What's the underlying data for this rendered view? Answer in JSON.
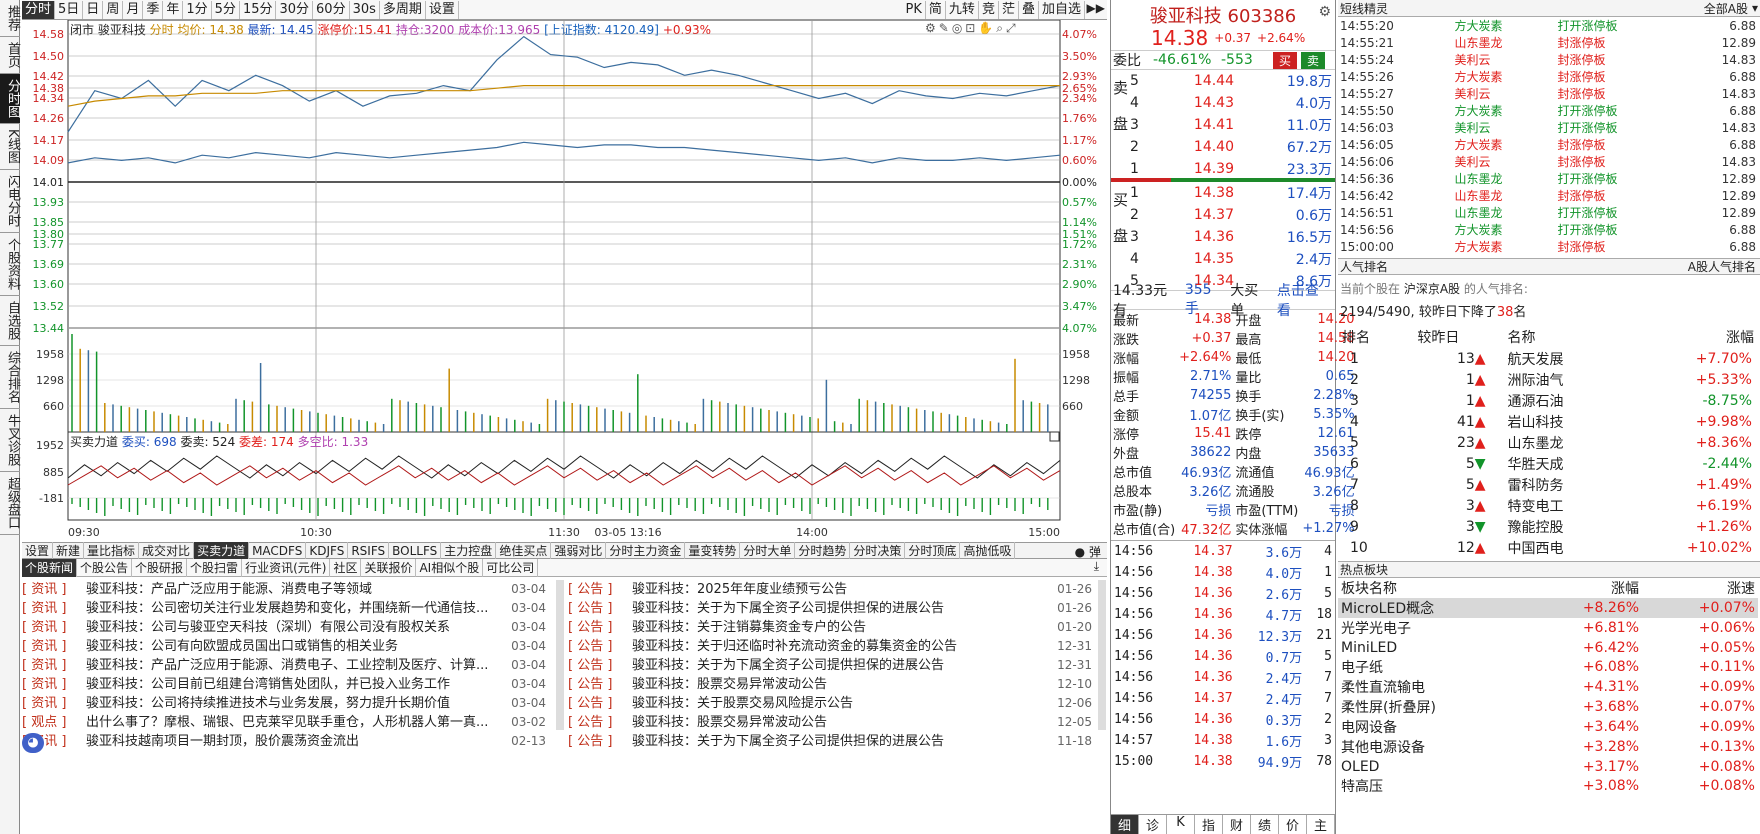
{
  "sidebar": [
    "推荐",
    "首页",
    "分时图",
    "K线图",
    "闪电分时",
    "个股资料",
    "自选股",
    "综合排名",
    "牛叉诊股",
    "超级盘口"
  ],
  "toolbar": {
    "items": [
      "分时",
      "5日",
      "日",
      "周",
      "月",
      "季",
      "年",
      "1分",
      "5分",
      "15分",
      "30分",
      "60分",
      "30s",
      "多周期",
      "设置"
    ],
    "right_items": [
      "PK",
      "简",
      "九转",
      "竞",
      "茫",
      "叠",
      "加自选"
    ]
  },
  "chart_header": {
    "stock": "闭市 骏亚科技",
    "period_label": "分时",
    "avg_label": "均价: 14.38",
    "latest_label": "最新: 14.45",
    "limit_label": "涨停价:15.41",
    "hold_label": "持仓:3200",
    "cost_label": "成本价:13.965",
    "index_label": "[上证指数: 4120.49]",
    "index_change": "+0.93%"
  },
  "price_axis": {
    "left": [
      "14.58",
      "14.50",
      "14.42",
      "14.38",
      "14.34",
      "14.26",
      "14.17",
      "14.09",
      "14.01",
      "13.93",
      "13.85",
      "13.80",
      "13.77",
      "13.69",
      "13.60",
      "13.52",
      "13.44"
    ],
    "right": [
      "4.07%",
      "3.50%",
      "2.93%",
      "2.65%",
      "2.34%",
      "1.76%",
      "1.17%",
      "0.60%",
      "0.00%",
      "0.57%",
      "1.14%",
      "1.51%",
      "1.72%",
      "2.31%",
      "2.90%",
      "3.47%",
      "4.07%"
    ],
    "volume_left": [
      "1958",
      "1298",
      "660"
    ],
    "volume_right": [
      "1958",
      "1298",
      "660"
    ],
    "macd_left": [
      "1952",
      "885",
      "-181"
    ]
  },
  "indicator_header": {
    "name": "买卖力道",
    "buy": "委买: 698",
    "sell": "委卖: 524",
    "diff": "委差: 174",
    "ratio": "多空比: 1.33"
  },
  "time_axis": [
    "09:30",
    "10:30",
    "11:30",
    "03-05 13:16",
    "14:00",
    "15:00"
  ],
  "bottom_tabs": [
    "设置",
    "新建",
    "量比指标",
    "成交对比",
    "买卖力道",
    "MACDFS",
    "KDJFS",
    "RSIFS",
    "BOLLFS",
    "主力控盘",
    "绝佳买点",
    "强弱对比",
    "分时主力资金",
    "量变转势",
    "分时大单",
    "分时趋势",
    "分时决策",
    "分时顶底",
    "高抛低吸"
  ],
  "bottom_toggle": "弹",
  "news_tabs": [
    "个股新闻",
    "个股公告",
    "个股研报",
    "个股扫雷",
    "行业资讯(元件)",
    "社区",
    "关联报价",
    "AI相似个股",
    "可比公司"
  ],
  "news_left": [
    {
      "tag": "[ 资讯 ]",
      "text": "骏亚科技：产品广泛应用于能源、消费电子等领域",
      "date": "03-04"
    },
    {
      "tag": "[ 资讯 ]",
      "text": "骏亚科技：公司密切关注行业发展趋势和变化，并围绕新一代通信技...",
      "date": "03-04"
    },
    {
      "tag": "[ 资讯 ]",
      "text": "骏亚科技：公司与骏亚空天科技（深圳）有限公司没有股权关系",
      "date": "03-04"
    },
    {
      "tag": "[ 资讯 ]",
      "text": "骏亚科技：公司有向欧盟成员国出口或销售的相关业务",
      "date": "03-04"
    },
    {
      "tag": "[ 资讯 ]",
      "text": "骏亚科技：产品广泛应用于能源、消费电子、工业控制及医疗、计算...",
      "date": "03-04"
    },
    {
      "tag": "[ 资讯 ]",
      "text": "骏亚科技：公司目前已组建台湾销售处团队，并已投入业务工作",
      "date": "03-04"
    },
    {
      "tag": "[ 资讯 ]",
      "text": "骏亚科技：公司将持续推进技术与业务发展，努力提升长期价值",
      "date": "03-04"
    },
    {
      "tag": "[ 观点 ]",
      "text": "出什么事了？摩根、瑞银、巴克莱罕见联手重仓，人形机器人第一真...",
      "date": "03-02"
    },
    {
      "tag": "[ 资讯 ]",
      "text": "骏亚科技越南项目一期封顶，股价震荡资金流出",
      "date": "02-13"
    }
  ],
  "news_right": [
    {
      "tag": "[ 公告 ]",
      "text": "骏亚科技：2025年年度业绩预亏公告",
      "date": "01-26"
    },
    {
      "tag": "[ 公告 ]",
      "text": "骏亚科技：关于为下属全资子公司提供担保的进展公告",
      "date": "01-26"
    },
    {
      "tag": "[ 公告 ]",
      "text": "骏亚科技：关于注销募集资金专户的公告",
      "date": "01-20"
    },
    {
      "tag": "[ 公告 ]",
      "text": "骏亚科技：关于归还临时补充流动资金的募集资金的公告",
      "date": "12-31"
    },
    {
      "tag": "[ 公告 ]",
      "text": "骏亚科技：关于为下属全资子公司提供担保的进展公告",
      "date": "12-31"
    },
    {
      "tag": "[ 公告 ]",
      "text": "骏亚科技：股票交易异常波动公告",
      "date": "12-10"
    },
    {
      "tag": "[ 公告 ]",
      "text": "骏亚科技：关于股票交易风险提示公告",
      "date": "12-06"
    },
    {
      "tag": "[ 公告 ]",
      "text": "骏亚科技：股票交易异常波动公告",
      "date": "12-05"
    },
    {
      "tag": "[ 公告 ]",
      "text": "骏亚科技：关于为下属全资子公司提供担保的进展公告",
      "date": "11-18"
    }
  ],
  "quote": {
    "name": "骏亚科技",
    "code": "603386",
    "price": "14.38",
    "change": "+0.37",
    "pct": "+2.64%",
    "buy_btn": "买",
    "sell_btn": "卖",
    "wei_label": "委比",
    "wei_ratio": "-46.61%",
    "wei_diff": "-553",
    "sell_label": "卖盘",
    "buy_label": "买盘",
    "sells": [
      {
        "n": "5",
        "p": "14.44",
        "v": "19.8万"
      },
      {
        "n": "4",
        "p": "14.43",
        "v": "4.0万"
      },
      {
        "n": "3",
        "p": "14.41",
        "v": "11.0万"
      },
      {
        "n": "2",
        "p": "14.40",
        "v": "67.2万"
      },
      {
        "n": "1",
        "p": "14.39",
        "v": "23.3万"
      }
    ],
    "buys": [
      {
        "n": "1",
        "p": "14.38",
        "v": "17.4万"
      },
      {
        "n": "2",
        "p": "14.37",
        "v": "0.6万"
      },
      {
        "n": "3",
        "p": "14.36",
        "v": "16.5万"
      },
      {
        "n": "4",
        "p": "14.35",
        "v": "2.4万"
      },
      {
        "n": "5",
        "p": "14.34",
        "v": "8.6万"
      }
    ],
    "bigorder": {
      "price": "14.33元有",
      "vol": "355手",
      "label": "大买单",
      "link": "点击查看"
    },
    "stats": [
      [
        "最新",
        "14.38",
        "开盘",
        "14.20"
      ],
      [
        "涨跌",
        "+0.37",
        "最高",
        "14.58"
      ],
      [
        "涨幅",
        "+2.64%",
        "最低",
        "14.20"
      ],
      [
        "振幅",
        "2.71%",
        "量比",
        "0.65"
      ],
      [
        "总手",
        "74255",
        "换手",
        "2.28%"
      ],
      [
        "金额",
        "1.07亿",
        "换手(实)",
        "5.35%"
      ],
      [
        "涨停",
        "15.41",
        "跌停",
        "12.61"
      ],
      [
        "外盘",
        "38622",
        "内盘",
        "35633"
      ],
      [
        "总市值",
        "46.93亿",
        "流通值",
        "46.93亿"
      ],
      [
        "总股本",
        "3.26亿",
        "流通股",
        "3.26亿"
      ],
      [
        "市盈(静)",
        "亏损",
        "市盈(TTM)",
        "亏损"
      ],
      [
        "总市值(合)",
        "47.32亿",
        "实体涨幅",
        "+1.27%"
      ]
    ],
    "ticks": [
      [
        "14:56",
        "14.37",
        "3.6万",
        "4"
      ],
      [
        "14:56",
        "14.38",
        "4.0万",
        "1"
      ],
      [
        "14:56",
        "14.36",
        "2.6万",
        "5"
      ],
      [
        "14:56",
        "14.36",
        "4.7万",
        "18"
      ],
      [
        "14:56",
        "14.36",
        "12.3万",
        "21"
      ],
      [
        "14:56",
        "14.36",
        "0.7万",
        "5"
      ],
      [
        "14:56",
        "14.36",
        "2.4万",
        "7"
      ],
      [
        "14:56",
        "14.37",
        "2.4万",
        "7"
      ],
      [
        "14:56",
        "14.36",
        "0.3万",
        "2"
      ],
      [
        "14:57",
        "14.38",
        "1.6万",
        "3"
      ],
      [
        "15:00",
        "14.38",
        "94.9万",
        "78"
      ]
    ],
    "bottom_tabs": [
      "细",
      "诊",
      "K",
      "指",
      "财",
      "绩",
      "价",
      "主"
    ]
  },
  "short_elves": {
    "title": "短线精灵",
    "filter": "全部A股",
    "rows": [
      [
        "14:55:20",
        "方大炭素",
        "打开涨停板",
        "6.88"
      ],
      [
        "14:55:21",
        "山东墨龙",
        "封涨停板",
        "12.89"
      ],
      [
        "14:55:24",
        "美利云",
        "封涨停板",
        "14.83"
      ],
      [
        "14:55:26",
        "方大炭素",
        "封涨停板",
        "6.88"
      ],
      [
        "14:55:27",
        "美利云",
        "封涨停板",
        "14.83"
      ],
      [
        "14:55:50",
        "方大炭素",
        "打开涨停板",
        "6.88"
      ],
      [
        "14:56:03",
        "美利云",
        "打开涨停板",
        "14.83"
      ],
      [
        "14:56:05",
        "方大炭素",
        "封涨停板",
        "6.88"
      ],
      [
        "14:56:06",
        "美利云",
        "封涨停板",
        "14.83"
      ],
      [
        "14:56:36",
        "山东墨龙",
        "打开涨停板",
        "12.89"
      ],
      [
        "14:56:42",
        "山东墨龙",
        "封涨停板",
        "12.89"
      ],
      [
        "14:56:51",
        "山东墨龙",
        "打开涨停板",
        "12.89"
      ],
      [
        "14:56:56",
        "方大炭素",
        "打开涨停板",
        "6.88"
      ],
      [
        "15:00:00",
        "方大炭素",
        "封涨停板",
        "6.88"
      ]
    ]
  },
  "popularity": {
    "title": "人气排名",
    "tab": "A股人气排名",
    "line1_pre": "当前个股在",
    "line1_market": "沪深京A股",
    "line1_post": "的人气排名:",
    "rank_text": "2194/5490, 较昨日下降了",
    "rank_drop": "38",
    "rank_unit": "名",
    "headers": [
      "排名",
      "较昨日",
      "名称",
      "涨幅"
    ],
    "rows": [
      {
        "r": "1",
        "d": "13",
        "up": true,
        "n": "航天发展",
        "p": "+7.70%"
      },
      {
        "r": "2",
        "d": "1",
        "up": true,
        "n": "洲际油气",
        "p": "+5.33%"
      },
      {
        "r": "3",
        "d": "1",
        "up": true,
        "n": "通源石油",
        "p": "-8.75%"
      },
      {
        "r": "4",
        "d": "41",
        "up": true,
        "n": "岩山科技",
        "p": "+9.98%"
      },
      {
        "r": "5",
        "d": "23",
        "up": true,
        "n": "山东墨龙",
        "p": "+8.36%"
      },
      {
        "r": "6",
        "d": "5",
        "up": false,
        "n": "华胜天成",
        "p": "-2.44%"
      },
      {
        "r": "7",
        "d": "5",
        "up": true,
        "n": "雷科防务",
        "p": "+1.49%"
      },
      {
        "r": "8",
        "d": "3",
        "up": true,
        "n": "特变电工",
        "p": "+6.19%"
      },
      {
        "r": "9",
        "d": "3",
        "up": false,
        "n": "豫能控股",
        "p": "+1.26%"
      },
      {
        "r": "10",
        "d": "12",
        "up": true,
        "n": "中国西电",
        "p": "+10.02%"
      }
    ]
  },
  "hot_sectors": {
    "title": "热点板块",
    "headers": [
      "板块名称",
      "涨幅",
      "涨速"
    ],
    "rows": [
      [
        "MicroLED概念",
        "+8.26%",
        "+0.07%"
      ],
      [
        "光学光电子",
        "+6.81%",
        "+0.06%"
      ],
      [
        "MiniLED",
        "+6.42%",
        "+0.05%"
      ],
      [
        "电子纸",
        "+6.08%",
        "+0.11%"
      ],
      [
        "柔性直流输电",
        "+4.31%",
        "+0.09%"
      ],
      [
        "柔性屏(折叠屏)",
        "+3.68%",
        "+0.07%"
      ],
      [
        "电网设备",
        "+3.64%",
        "+0.09%"
      ],
      [
        "其他电源设备",
        "+3.28%",
        "+0.13%"
      ],
      [
        "OLED",
        "+3.17%",
        "+0.08%"
      ],
      [
        "特高压",
        "+3.08%",
        "+0.08%"
      ]
    ]
  },
  "chart_data": {
    "type": "line",
    "title": "",
    "x_range": [
      "09:30",
      "15:00"
    ],
    "ylim": [
      13.44,
      14.58
    ],
    "prev_close": 14.01,
    "series": [
      {
        "name": "",
        "color": "#3c6e9e",
        "values": [
          14.2,
          14.36,
          14.33,
          14.4,
          14.3,
          14.4,
          14.36,
          14.42,
          14.38,
          14.32,
          14.36,
          14.3,
          14.34,
          14.35,
          14.38,
          14.36,
          14.48,
          14.57,
          14.5,
          14.49,
          14.45,
          14.47,
          14.46,
          14.42,
          14.44,
          14.42,
          14.39,
          14.36,
          14.33,
          14.35,
          14.31,
          14.36,
          14.34,
          14.33,
          14.35,
          14.34,
          14.36,
          14.38
        ]
      },
      {
        "name": "",
        "color": "#c78a00",
        "values": [
          14.3,
          14.32,
          14.33,
          14.34,
          14.34,
          14.35,
          14.35,
          14.35,
          14.36,
          14.36,
          14.36,
          14.36,
          14.36,
          14.36,
          14.36,
          14.36,
          14.37,
          14.38,
          14.38,
          14.38,
          14.38,
          14.38,
          14.38,
          14.38,
          14.38,
          14.38,
          14.38,
          14.38,
          14.38,
          14.38,
          14.38,
          14.38,
          14.38,
          14.38,
          14.38,
          14.38,
          14.38,
          14.38
        ]
      },
      {
        "name": "",
        "color": "#3c6e9e",
        "values": [
          14.08,
          14.1,
          14.09,
          14.1,
          14.08,
          14.11,
          14.1,
          14.12,
          14.11,
          14.1,
          14.12,
          14.11,
          14.1,
          14.11,
          14.12,
          14.13,
          14.14,
          14.16,
          14.15,
          14.14,
          14.15,
          14.15,
          14.14,
          14.14,
          14.13,
          14.12,
          14.11,
          14.1,
          14.09,
          14.1,
          14.08,
          14.1,
          14.09,
          14.09,
          14.1,
          14.09,
          14.1,
          14.11
        ]
      }
    ]
  },
  "colors": {
    "up": "#e0201c",
    "down": "#12942a",
    "accent": "#1d4fbf"
  }
}
